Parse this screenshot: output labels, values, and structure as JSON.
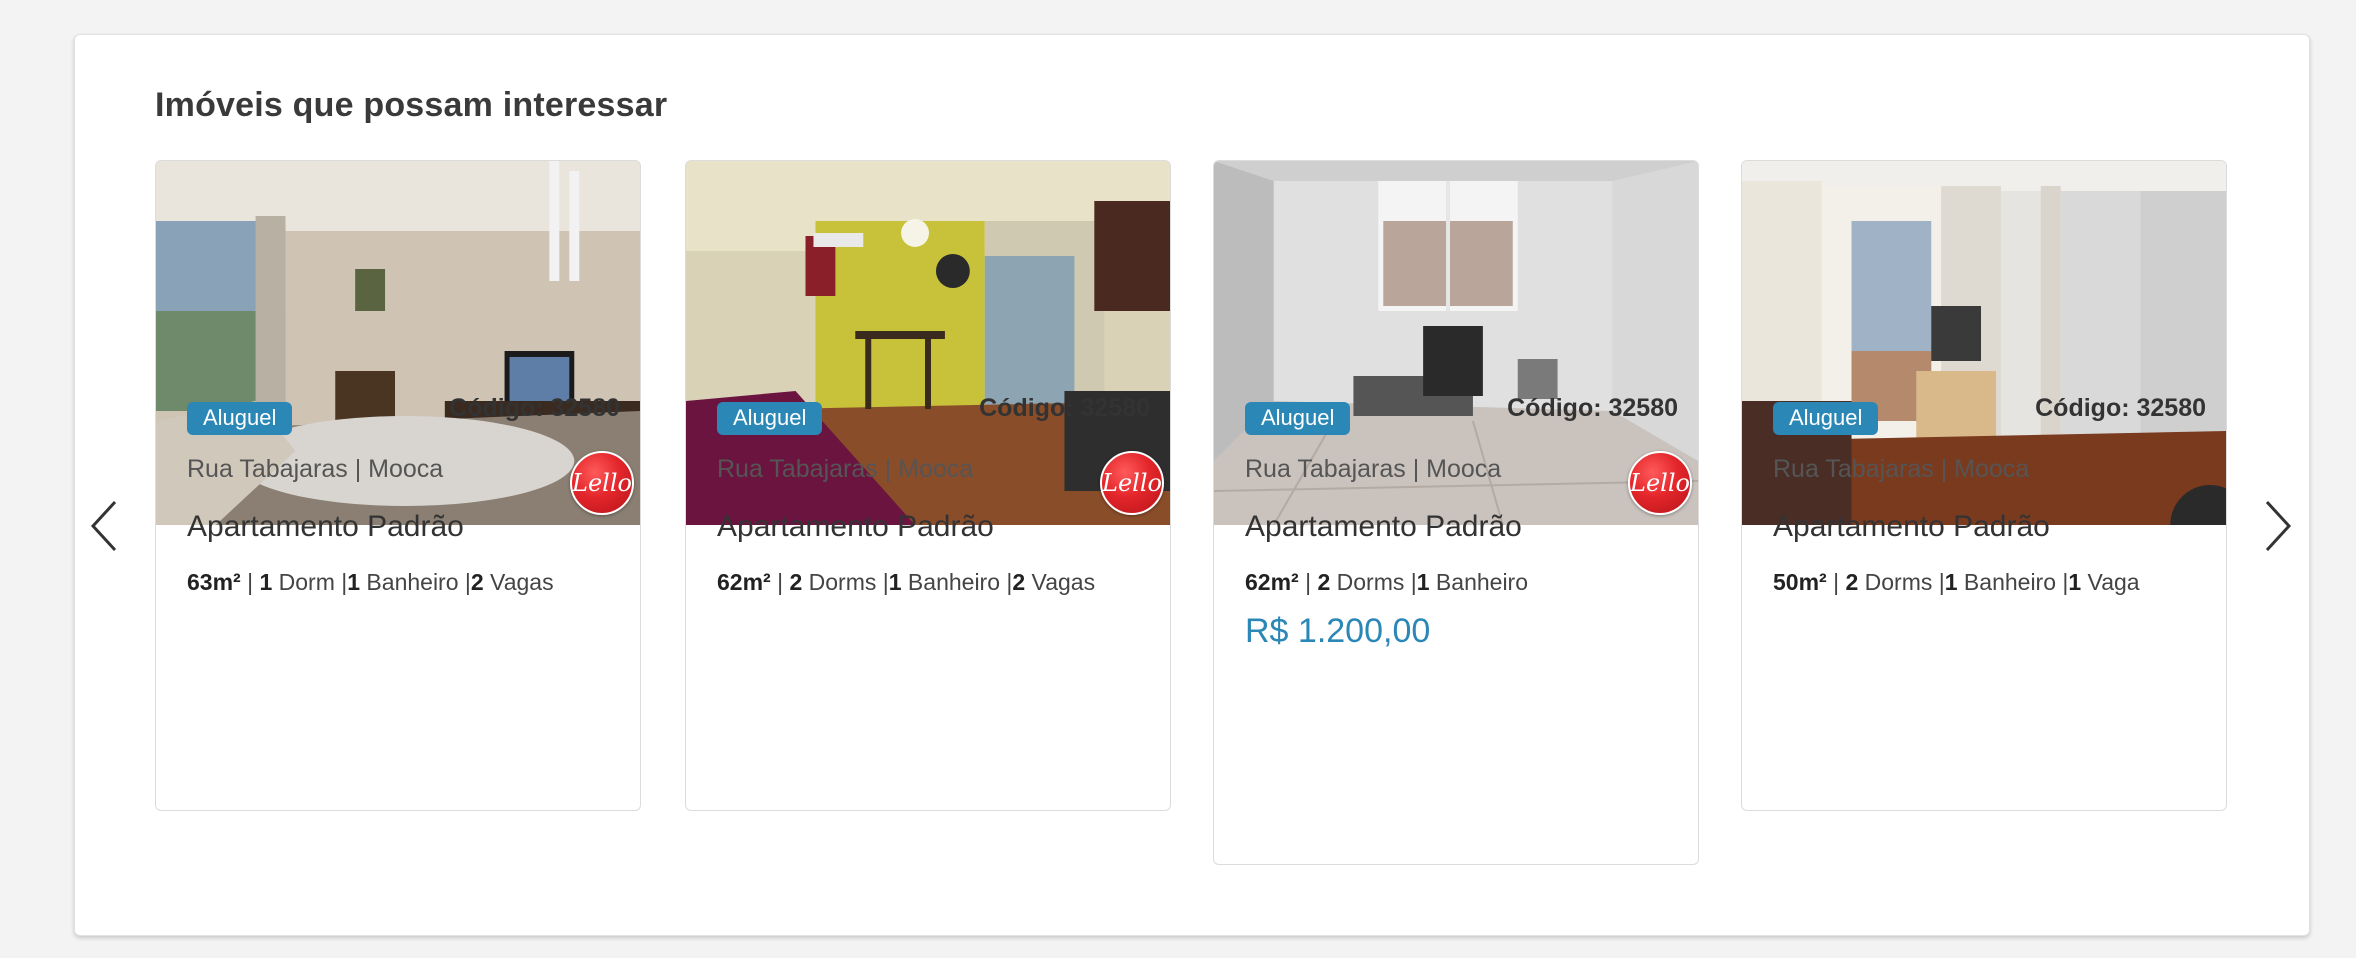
{
  "section": {
    "title": "Imóveis que possam interessar"
  },
  "nav": {
    "prev_icon": "chevron-left-icon",
    "next_icon": "chevron-right-icon"
  },
  "brand": {
    "logo_text": "Lello",
    "logo_color": "#e3262b"
  },
  "accent_color": "#2b87b5",
  "cards": [
    {
      "badge": "Aluguel",
      "code": "Código: 32580",
      "address": "Rua Tabajaras | Mooca",
      "type": "Apartamento Padrão",
      "area": "63m²",
      "sep1": " | ",
      "dorms_num": "1",
      "dorms_label": " Dorm |",
      "baths_num": "1",
      "baths_label": " Banheiro |",
      "vagas_num": "2",
      "vagas_label": " Vagas",
      "price": "",
      "has_logo": true
    },
    {
      "badge": "Aluguel",
      "code": "Código: 32580",
      "address": "Rua Tabajaras | Mooca",
      "type": "Apartamento Padrão",
      "area": "62m²",
      "sep1": " | ",
      "dorms_num": "2",
      "dorms_label": " Dorms |",
      "baths_num": "1",
      "baths_label": " Banheiro |",
      "vagas_num": "2",
      "vagas_label": " Vagas",
      "price": "",
      "has_logo": true
    },
    {
      "badge": "Aluguel",
      "code": "Código: 32580",
      "address": "Rua Tabajaras | Mooca",
      "type": "Apartamento Padrão",
      "area": "62m²",
      "sep1": " | ",
      "dorms_num": "2",
      "dorms_label": " Dorms |",
      "baths_num": "1",
      "baths_label": " Banheiro",
      "vagas_num": "",
      "vagas_label": "",
      "price": "R$ 1.200,00",
      "has_logo": true
    },
    {
      "badge": "Aluguel",
      "code": "Código: 32580",
      "address": "Rua Tabajaras | Mooca",
      "type": "Apartamento Padrão",
      "area": "50m²",
      "sep1": " | ",
      "dorms_num": "2",
      "dorms_label": " Dorms |",
      "baths_num": "1",
      "baths_label": " Banheiro |",
      "vagas_num": "1",
      "vagas_label": " Vaga",
      "price": "",
      "has_logo": false
    }
  ]
}
